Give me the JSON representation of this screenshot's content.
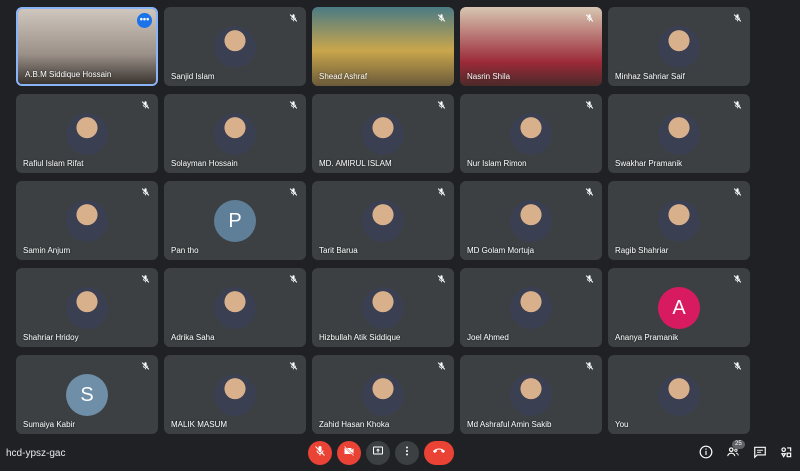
{
  "tiles": [
    {
      "name": "A.B.M Siddique Hossain",
      "kind": "video",
      "pinned": true
    },
    {
      "name": "Sanjid Islam",
      "kind": "photo"
    },
    {
      "name": "Shead Ashraf",
      "kind": "video"
    },
    {
      "name": "Nasrin Shila",
      "kind": "video"
    },
    {
      "name": "Minhaz Sahriar Saif",
      "kind": "photo"
    },
    {
      "name": "Rafiul Islam Rifat",
      "kind": "photo"
    },
    {
      "name": "Solayman Hossain",
      "kind": "photo"
    },
    {
      "name": "MD. AMIRUL ISLAM",
      "kind": "photo"
    },
    {
      "name": "Nur Islam Rimon",
      "kind": "photo"
    },
    {
      "name": "Swakhar Pramanik",
      "kind": "photo"
    },
    {
      "name": "Samin Anjum",
      "kind": "photo"
    },
    {
      "name": "Pan tho",
      "kind": "letter",
      "letter": "P",
      "color": "#5f7f99"
    },
    {
      "name": "Tarit Barua",
      "kind": "photo"
    },
    {
      "name": "MD Golam Mortuja",
      "kind": "photo"
    },
    {
      "name": "Ragib Shahriar",
      "kind": "photo"
    },
    {
      "name": "Shahriar Hridoy",
      "kind": "photo"
    },
    {
      "name": "Adrika Saha",
      "kind": "photo"
    },
    {
      "name": "Hizbullah Atik Siddique",
      "kind": "photo"
    },
    {
      "name": "Joel Ahmed",
      "kind": "photo"
    },
    {
      "name": "Ananya Pramanik",
      "kind": "letter",
      "letter": "A",
      "color": "#d81b60"
    },
    {
      "name": "Sumaiya Kabir",
      "kind": "letter",
      "letter": "S",
      "color": "#6f8fa8"
    },
    {
      "name": "MALIK MASUM",
      "kind": "photo"
    },
    {
      "name": "Zahid Hasan Khoka",
      "kind": "photo"
    },
    {
      "name": "Md Ashraful Amin Sakib",
      "kind": "photo"
    },
    {
      "name": "You",
      "kind": "photo"
    }
  ],
  "meeting_code": "hcd-ypsz-gac",
  "participants_count": "25",
  "colors": {
    "accent": "#8ab4f8",
    "danger": "#ea4335",
    "tile": "#3c4043",
    "bg": "#202124"
  }
}
